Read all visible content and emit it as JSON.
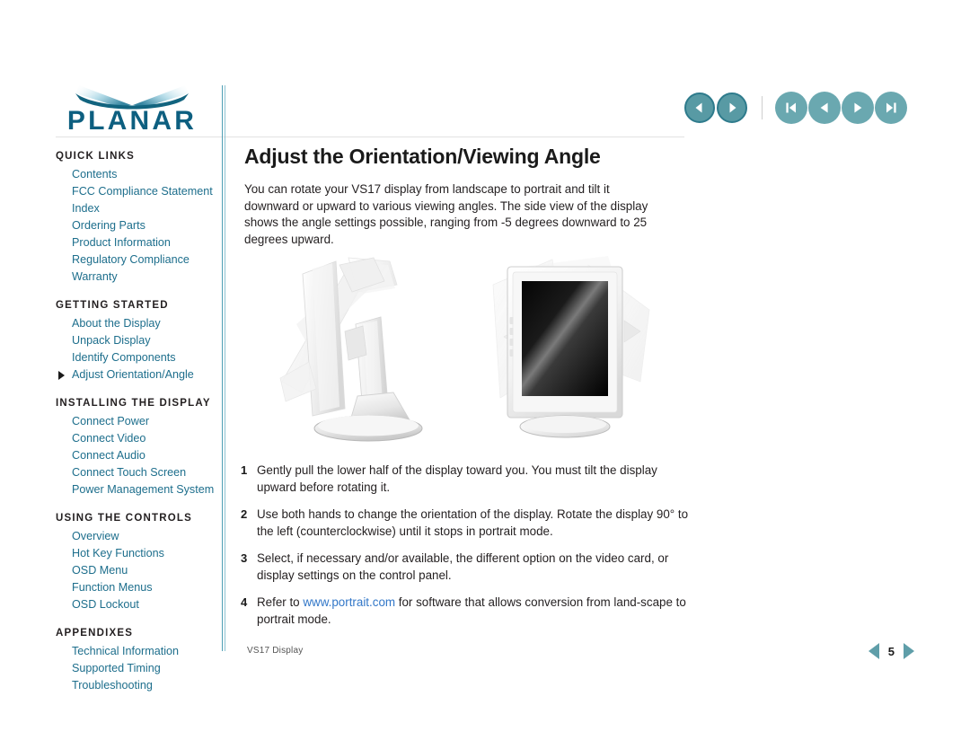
{
  "brand": {
    "logo_text": "PLANAR",
    "logo_name": "planar-logo"
  },
  "topnav": {
    "history_back": "back-arrow",
    "history_forward": "forward-arrow",
    "first_page": "first-page",
    "prev_page": "previous-page",
    "next_page": "next-page",
    "last_page": "last-page"
  },
  "sidebar": {
    "sections": [
      {
        "heading": "QUICK LINKS",
        "items": [
          {
            "label": "Contents",
            "active": false
          },
          {
            "label": "FCC Compliance Statement",
            "active": false
          },
          {
            "label": "Index",
            "active": false
          },
          {
            "label": "Ordering Parts",
            "active": false
          },
          {
            "label": "Product Information",
            "active": false
          },
          {
            "label": "Regulatory Compliance",
            "active": false
          },
          {
            "label": "Warranty",
            "active": false
          }
        ]
      },
      {
        "heading": "GETTING STARTED",
        "items": [
          {
            "label": "About the Display",
            "active": false
          },
          {
            "label": "Unpack Display",
            "active": false
          },
          {
            "label": "Identify Components",
            "active": false
          },
          {
            "label": "Adjust Orientation/Angle",
            "active": true
          }
        ]
      },
      {
        "heading": "INSTALLING THE DISPLAY",
        "items": [
          {
            "label": "Connect Power",
            "active": false
          },
          {
            "label": "Connect Video",
            "active": false
          },
          {
            "label": "Connect Audio",
            "active": false
          },
          {
            "label": "Connect Touch Screen",
            "active": false
          },
          {
            "label": "Power Management System",
            "active": false
          }
        ]
      },
      {
        "heading": "USING THE CONTROLS",
        "items": [
          {
            "label": "Overview",
            "active": false
          },
          {
            "label": "Hot Key Functions",
            "active": false
          },
          {
            "label": "OSD Menu",
            "active": false
          },
          {
            "label": "Function Menus",
            "active": false
          },
          {
            "label": "OSD Lockout",
            "active": false
          }
        ]
      },
      {
        "heading": "APPENDIXES",
        "items": [
          {
            "label": "Technical Information",
            "active": false
          },
          {
            "label": "Supported Timing",
            "active": false
          },
          {
            "label": "Troubleshooting",
            "active": false
          }
        ]
      }
    ]
  },
  "main": {
    "title": "Adjust the Orientation/Viewing Angle",
    "intro": "You can rotate your VS17 display from landscape to portrait and tilt it downward or upward to various viewing angles. The side view of the display shows the angle settings possible, ranging from -5 degrees downward to 25 degrees upward.",
    "figures": {
      "left_alt": "monitor-side-view-tilt-range",
      "right_alt": "monitor-portrait-rotation"
    },
    "steps": [
      {
        "num": "1",
        "text": "Gently pull the lower half of the display toward you. You must tilt the display upward before rotating it."
      },
      {
        "num": "2",
        "text": "Use both hands to change the orientation of the display. Rotate the display 90° to the left (counterclockwise) until it stops in portrait mode."
      },
      {
        "num": "3",
        "text": "Select, if necessary and/or available, the different option on the video card, or display settings on the control panel."
      },
      {
        "num": "4",
        "text_before": "Refer to ",
        "link": "www.portrait.com",
        "text_after": " for software that allows conversion from land-scape to portrait mode."
      }
    ]
  },
  "footer": {
    "document_label": "VS17 Display",
    "page_number": "5",
    "prev_label": "previous-page-triangle",
    "next_label": "next-page-triangle"
  },
  "colors": {
    "link": "#1d6e8c",
    "hyperlink": "#3277c8",
    "accent_teal": "#589aa4",
    "accent_teal_dark": "#2e7b8c",
    "logo_blue": "#16678a",
    "heading_black": "#231f20"
  }
}
